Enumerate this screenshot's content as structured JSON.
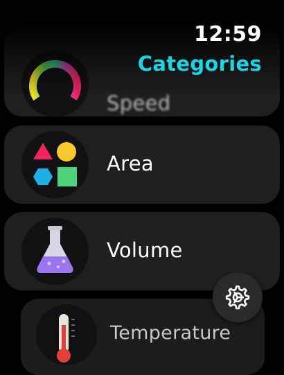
{
  "status": {
    "time": "12:59"
  },
  "header": {
    "title": "Categories",
    "title_color": "#18d6e4"
  },
  "categories": [
    {
      "label": "Speed",
      "icon": "speedometer-icon"
    },
    {
      "label": "Area",
      "icon": "shapes-icon"
    },
    {
      "label": "Volume",
      "icon": "flask-icon"
    },
    {
      "label": "Temperature",
      "icon": "thermometer-icon"
    }
  ],
  "settings_button": {
    "icon": "gear-icon"
  }
}
